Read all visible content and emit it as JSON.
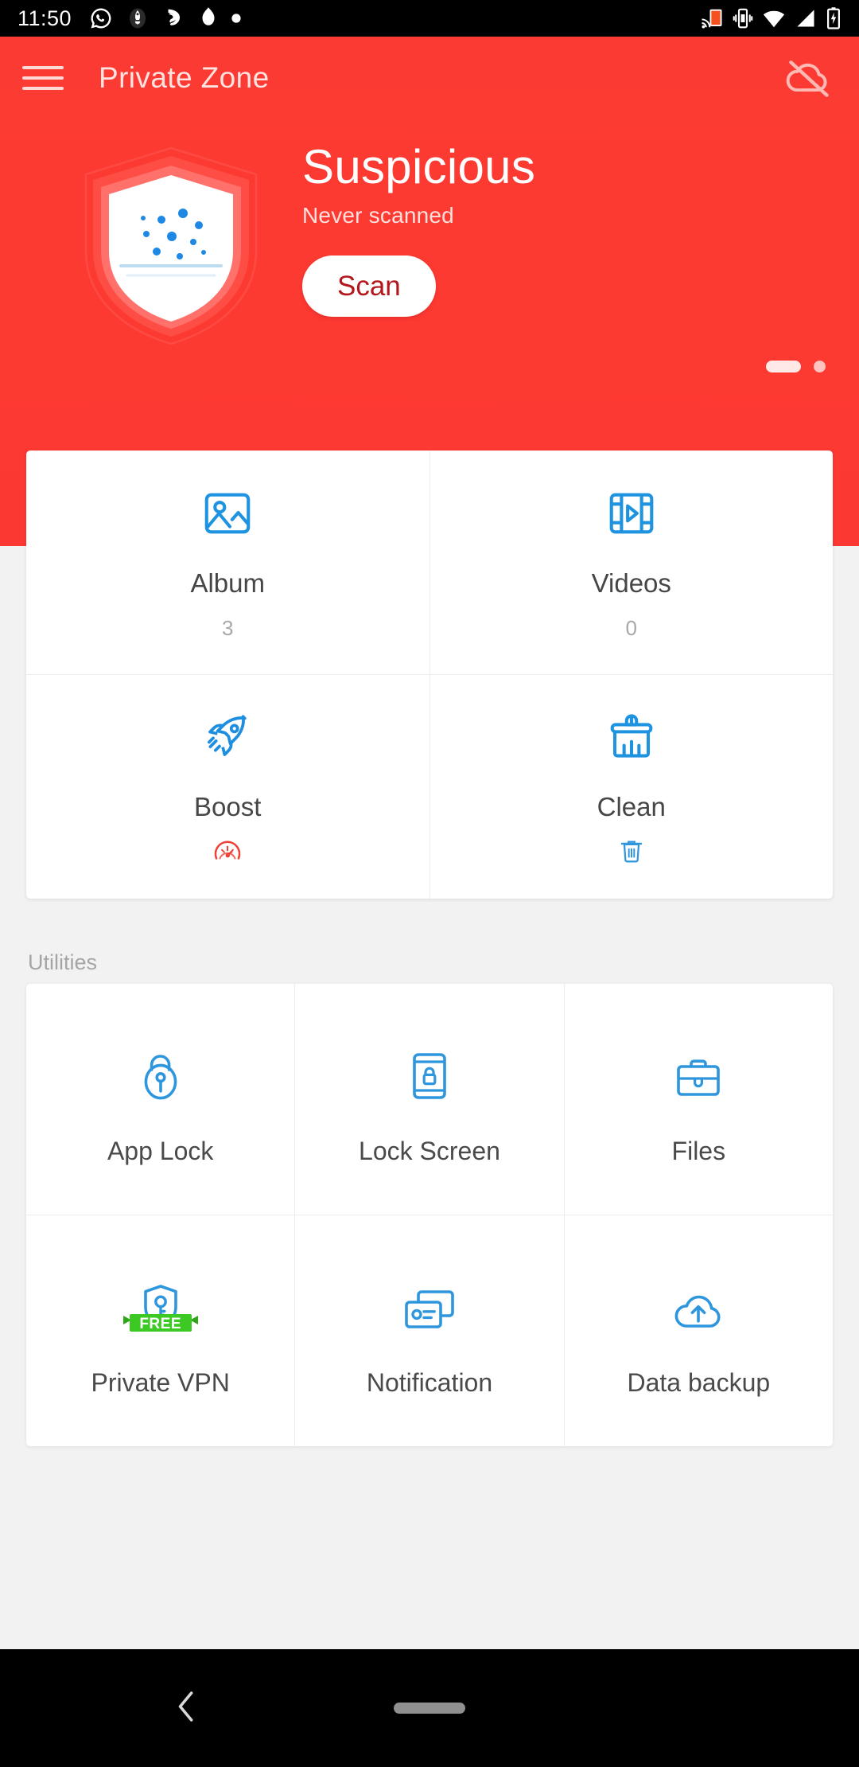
{
  "statusbar": {
    "time": "11:50",
    "left_icons": [
      "whatsapp-icon",
      "rocket-badge-icon",
      "lion-icon",
      "flame-icon",
      "dot-icon"
    ],
    "right_icons": [
      "screen-cast-icon",
      "vibrate-icon",
      "wifi-icon",
      "signal-icon",
      "battery-charging-icon"
    ]
  },
  "header": {
    "menu_icon": "hamburger-menu-icon",
    "title": "Private Zone",
    "cloud_icon": "cloud-off-icon",
    "status_title": "Suspicious",
    "status_subtitle": "Never scanned",
    "scan_label": "Scan",
    "accent_color": "#fd3a32",
    "scan_text_color": "#b3161b"
  },
  "pager": {
    "active_index": 0,
    "count": 2
  },
  "features": [
    {
      "label": "Album",
      "count": "3",
      "icon": "image-icon",
      "sub_icon": ""
    },
    {
      "label": "Videos",
      "count": "0",
      "icon": "film-play-icon",
      "sub_icon": ""
    },
    {
      "label": "Boost",
      "count": "",
      "icon": "rocket-icon",
      "sub_icon": "speedometer-icon"
    },
    {
      "label": "Clean",
      "count": "",
      "icon": "broom-icon",
      "sub_icon": "trash-icon"
    }
  ],
  "utilities": {
    "section_title": "Utilities",
    "items": [
      {
        "label": "App Lock",
        "icon": "padlock-icon",
        "badge": ""
      },
      {
        "label": "Lock Screen",
        "icon": "phone-lock-icon",
        "badge": ""
      },
      {
        "label": "Files",
        "icon": "briefcase-icon",
        "badge": ""
      },
      {
        "label": "Private VPN",
        "icon": "shield-key-icon",
        "badge": "FREE"
      },
      {
        "label": "Notification",
        "icon": "notification-cards-icon",
        "badge": ""
      },
      {
        "label": "Data backup",
        "icon": "cloud-upload-icon",
        "badge": ""
      }
    ],
    "badge_color": "#3dc924",
    "icon_color": "#2e96dd"
  },
  "navbar": {
    "back_icon": "back-chevron-icon",
    "home_icon": "home-pill-icon"
  }
}
